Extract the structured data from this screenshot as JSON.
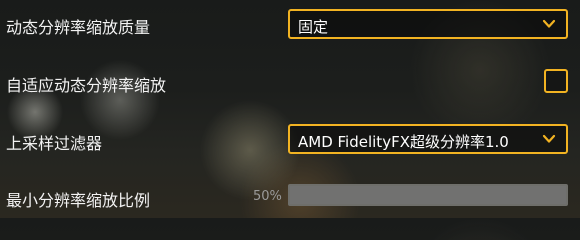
{
  "settings": {
    "dynamic_res_quality": {
      "label": "动态分辨率缩放质量",
      "value": "固定"
    },
    "adaptive_dynamic_res": {
      "label": "自适应动态分辨率缩放",
      "checked": false
    },
    "upsampling_filter": {
      "label": "上采样过滤器",
      "value": "AMD FidelityFX超级分辨率1.0"
    },
    "min_res_scale": {
      "label": "最小分辨率缩放比例",
      "percent_text": "50%",
      "value_percent": 50
    }
  },
  "colors": {
    "accent": "#f2b322",
    "text": "#f2f2f2",
    "slider_fill": "#717170"
  },
  "icons": {
    "dropdown": "chevron-down-icon"
  }
}
